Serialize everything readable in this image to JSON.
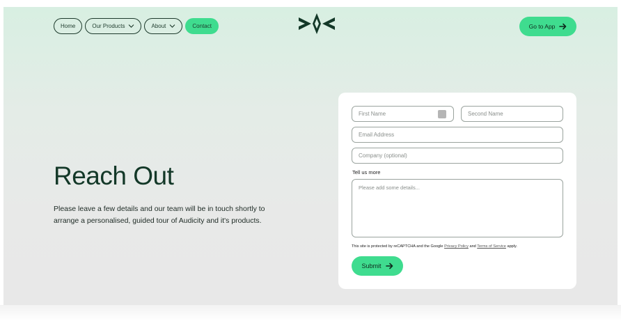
{
  "nav": {
    "home": "Home",
    "products": "Our Products",
    "about": "About",
    "contact": "Contact"
  },
  "header": {
    "go_to_app": "Go to App"
  },
  "hero": {
    "title": "Reach Out",
    "description": "Please leave a few details and our team will be in touch shortly to arrange a personalised, guided tour of Audicity and it's products."
  },
  "form": {
    "first_name_placeholder": "First Name",
    "second_name_placeholder": "Second Name",
    "email_placeholder": "Email Address",
    "company_placeholder": "Company (optional)",
    "tell_label": "Tell us more",
    "details_placeholder": "Please add some details...",
    "recaptcha": {
      "prefix": "This site is protected by reCAPTCHA and the Google ",
      "privacy": "Privacy Policy",
      "and": " and ",
      "terms": "Terms of Service",
      "suffix": " apply."
    },
    "submit": "Submit"
  },
  "colors": {
    "accent": "#3fdc8f",
    "brand_dark": "#133828"
  },
  "icons": {
    "chevron": "chevron-down-icon",
    "arrow": "arrow-right-icon",
    "logo": "audicity-logo"
  }
}
